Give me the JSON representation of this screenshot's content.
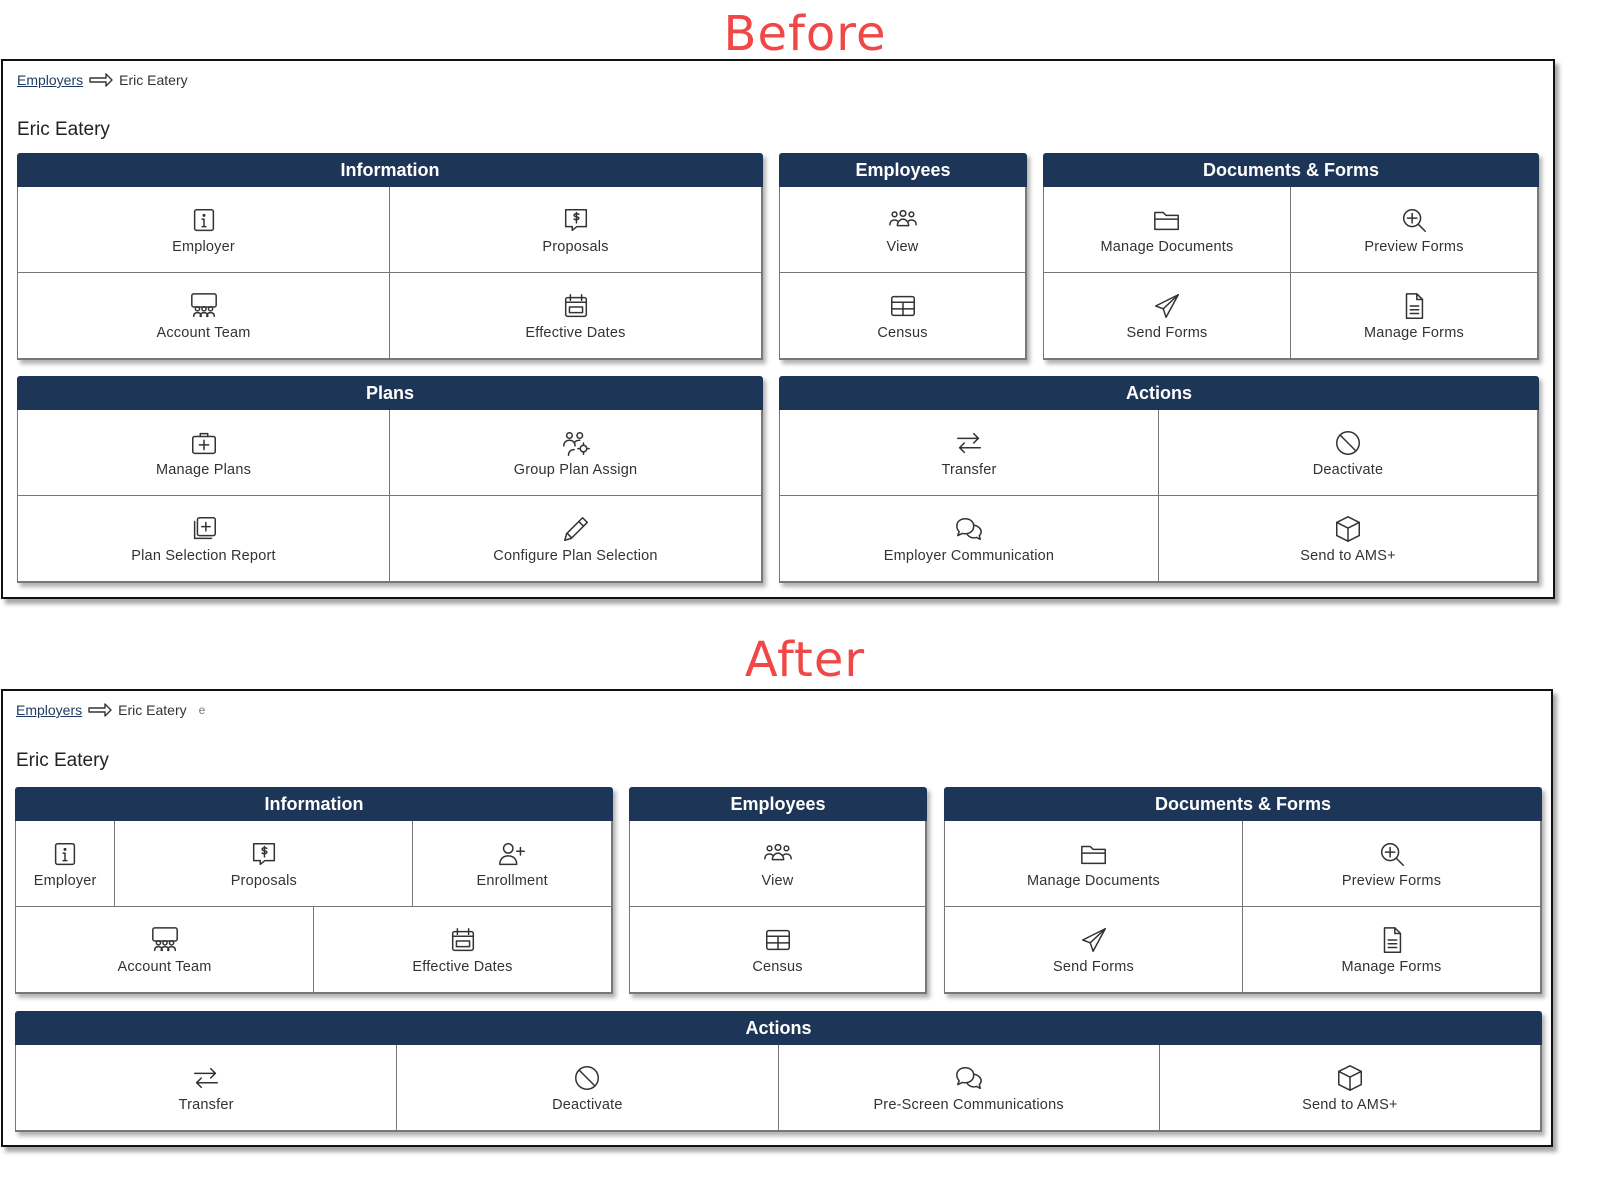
{
  "before": {
    "caption": "Before",
    "breadcrumb": {
      "link": "Employers",
      "current": "Eric Eatery"
    },
    "title": "Eric Eatery",
    "panels": {
      "information": {
        "header": "Information",
        "tiles": [
          "Employer",
          "Proposals",
          "Account Team",
          "Effective Dates"
        ]
      },
      "employees": {
        "header": "Employees",
        "tiles": [
          "View",
          "Census"
        ]
      },
      "documents": {
        "header": "Documents & Forms",
        "tiles": [
          "Manage Documents",
          "Preview Forms",
          "Send Forms",
          "Manage Forms"
        ]
      },
      "plans": {
        "header": "Plans",
        "tiles": [
          "Manage Plans",
          "Group Plan Assign",
          "Plan Selection Report",
          "Configure Plan Selection"
        ]
      },
      "actions": {
        "header": "Actions",
        "tiles": [
          "Transfer",
          "Deactivate",
          "Employer Communication",
          "Send to AMS+"
        ]
      }
    }
  },
  "after": {
    "caption": "After",
    "breadcrumb": {
      "link": "Employers",
      "current": "Eric Eatery",
      "stray": "e"
    },
    "title": "Eric Eatery",
    "panels": {
      "information": {
        "header": "Information",
        "tiles": [
          "Employer",
          "Proposals",
          "Enrollment",
          "Account Team",
          "Effective Dates"
        ]
      },
      "employees": {
        "header": "Employees",
        "tiles": [
          "View",
          "Census"
        ]
      },
      "documents": {
        "header": "Documents & Forms",
        "tiles": [
          "Manage Documents",
          "Preview Forms",
          "Send Forms",
          "Manage Forms"
        ]
      },
      "actions": {
        "header": "Actions",
        "tiles": [
          "Transfer",
          "Deactivate",
          "Pre-Screen Communications",
          "Send to AMS+"
        ]
      }
    }
  },
  "colors": {
    "header_bg": "#1d3658",
    "caption": "#f04848",
    "link": "#1f3a5f"
  }
}
